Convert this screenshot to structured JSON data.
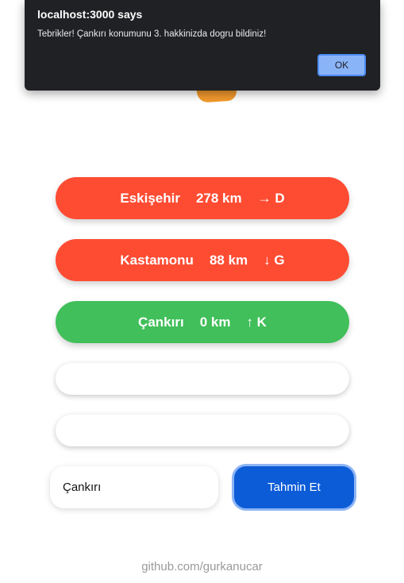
{
  "alert": {
    "title": "localhost:3000 says",
    "message": "Tebrikler! Çankırı konumunu 3. hakkinizda dogru bildiniz!",
    "ok_label": "OK"
  },
  "guesses": [
    {
      "city": "Eskişehir",
      "distance": "278 km",
      "direction": "→ D",
      "status": "wrong"
    },
    {
      "city": "Kastamonu",
      "distance": "88 km",
      "direction": "↓ G",
      "status": "wrong"
    },
    {
      "city": "Çankırı",
      "distance": "0 km",
      "direction": "↑ K",
      "status": "correct"
    }
  ],
  "input": {
    "value": "Çankırı",
    "placeholder": ""
  },
  "submit_label": "Tahmin Et",
  "footer": {
    "link_text": "github.com/gurkanucar"
  },
  "colors": {
    "wrong": "#fe4c33",
    "correct": "#41bf5a",
    "button": "#0d5cd7",
    "alert_bg": "#202124",
    "alert_ok": "#8ab4f8"
  }
}
